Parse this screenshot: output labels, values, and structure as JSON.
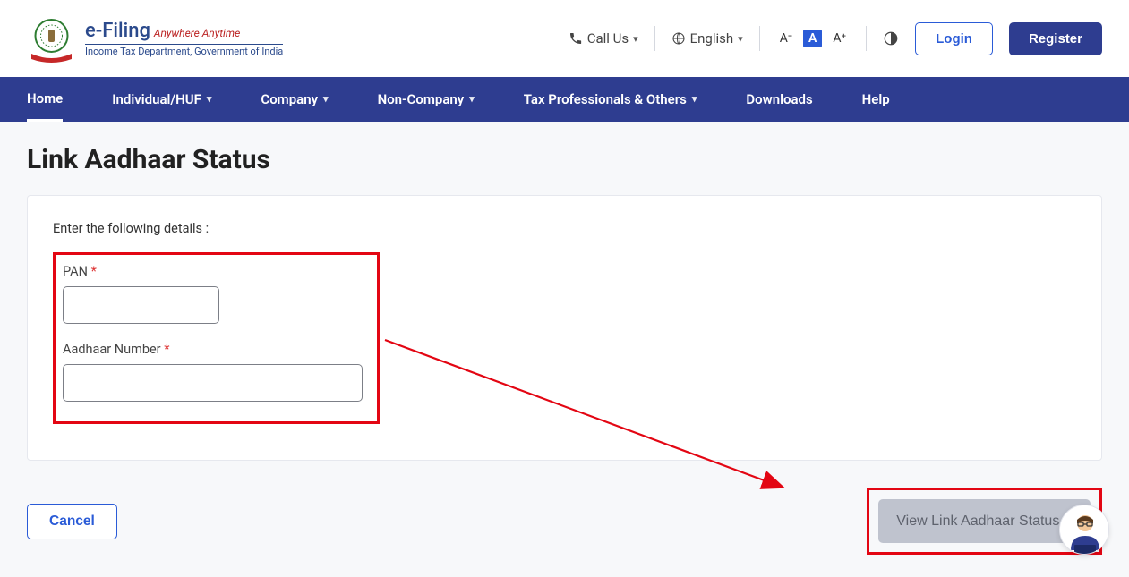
{
  "brand": {
    "title": "e-Filing",
    "subtitle": "Anywhere Anytime",
    "dept": "Income Tax Department, Government of India"
  },
  "top": {
    "call": "Call Us",
    "lang": "English",
    "fontDec": "A⁻",
    "fontDefault": "A",
    "fontInc": "A⁺",
    "login": "Login",
    "register": "Register"
  },
  "nav": {
    "home": "Home",
    "individual": "Individual/HUF",
    "company": "Company",
    "noncompany": "Non-Company",
    "taxpro": "Tax Professionals & Others",
    "downloads": "Downloads",
    "help": "Help"
  },
  "page": {
    "title": "Link Aadhaar Status",
    "instruction": "Enter the following details :",
    "pan_label": "PAN",
    "aadhaar_label": "Aadhaar Number",
    "required": "*",
    "pan_value": "",
    "aadhaar_value": "",
    "cancel": "Cancel",
    "submit": "View Link Aadhaar Status"
  }
}
